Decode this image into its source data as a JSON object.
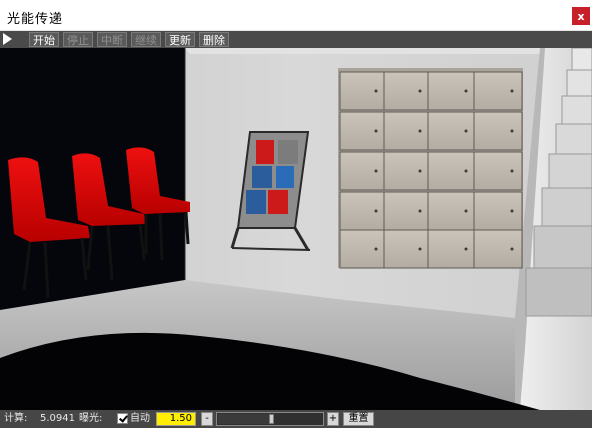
{
  "window": {
    "title": "光能传递",
    "close_label": "x"
  },
  "toolbar": {
    "play_icon": "play-icon",
    "buttons": [
      {
        "label": "开始",
        "enabled": true
      },
      {
        "label": "停止",
        "enabled": false
      },
      {
        "label": "中断",
        "enabled": false
      },
      {
        "label": "继续",
        "enabled": false
      },
      {
        "label": "更新",
        "enabled": true
      },
      {
        "label": "删除",
        "enabled": true
      }
    ]
  },
  "viewport": {
    "scene": "3D room render: three red chairs, magazine rack, wall lockers, staircase"
  },
  "statusbar": {
    "compute_label": "计算:",
    "compute_value": "5.0941",
    "exposure_label": "曝光:",
    "auto_label": "自动",
    "auto_checked": true,
    "exposure_value": "1.50",
    "minus_label": "-",
    "plus_label": "+",
    "reset_label": "重置",
    "slider_level": 0.52
  }
}
